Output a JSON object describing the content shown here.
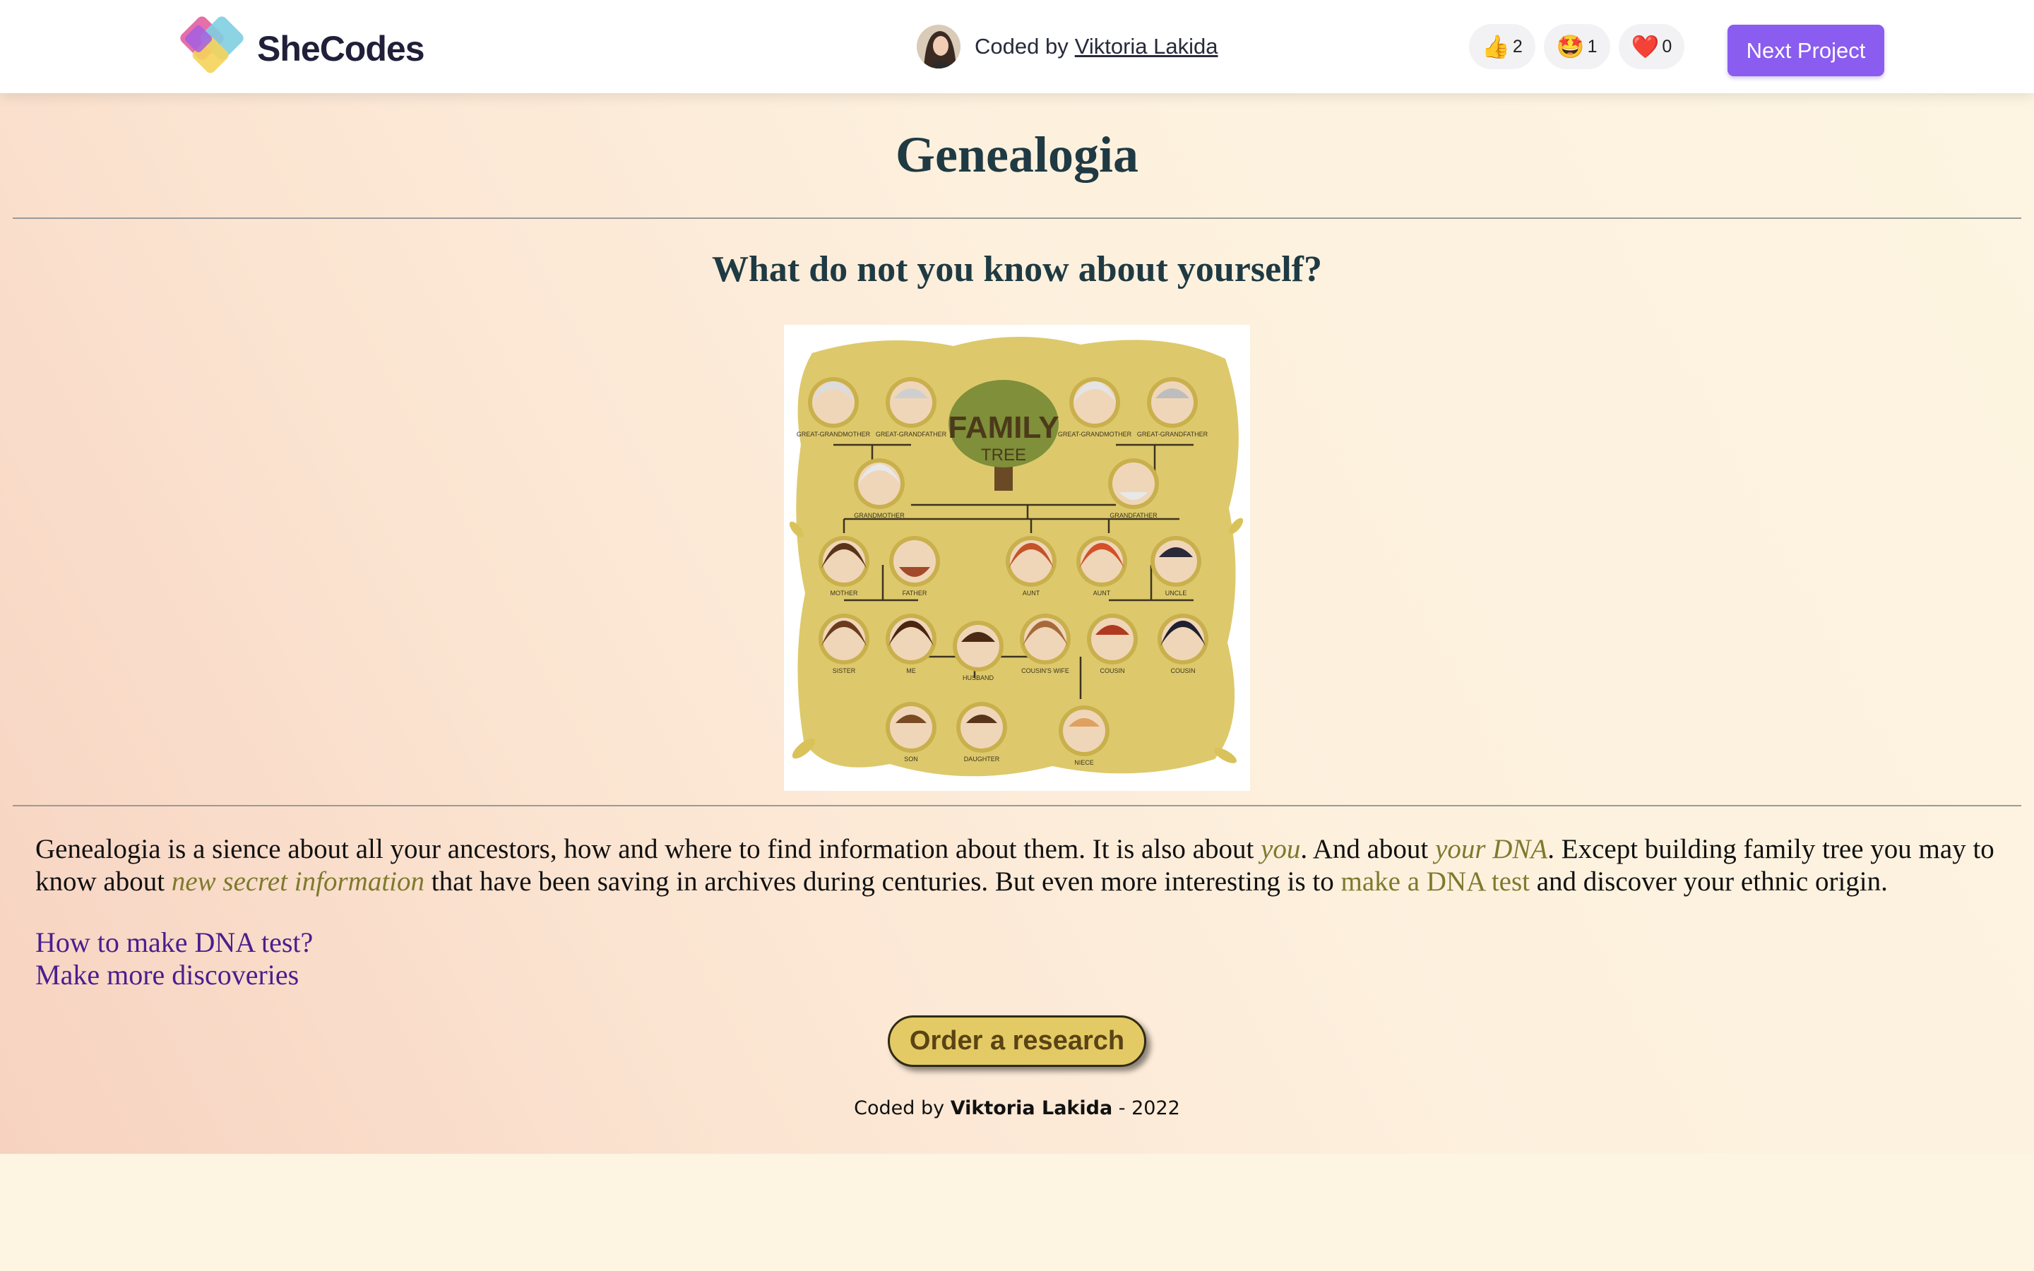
{
  "header": {
    "logo_text": "SheCodes",
    "coded_by_label": "Coded by",
    "author_name": "Viktoria Lakida",
    "reactions": [
      {
        "icon": "thumbs-up-icon",
        "glyph": "👍",
        "count": "2"
      },
      {
        "icon": "star-struck-icon",
        "glyph": "🤩",
        "count": "1"
      },
      {
        "icon": "heart-icon",
        "glyph": "❤️",
        "count": "0"
      }
    ],
    "next_button_label": "Next Project",
    "accent_color": "#8a5cf0"
  },
  "main": {
    "title": "Genealogia",
    "subtitle": "What do not you know about yourself?",
    "image": {
      "banner": "FAMILY",
      "banner_sub": "TREE",
      "labels": [
        "GREAT-GRANDMOTHER",
        "GREAT-GRANDFATHER",
        "GREAT-GRANDMOTHER",
        "GREAT-GRANDFATHER",
        "GRANDMOTHER",
        "GRANDFATHER",
        "MOTHER",
        "FATHER",
        "AUNT",
        "AUNT",
        "UNCLE",
        "SISTER",
        "ME",
        "HUSBAND",
        "COUSIN'S WIFE",
        "COUSIN",
        "COUSIN",
        "SON",
        "DAUGHTER",
        "NIECE"
      ]
    },
    "paragraph": {
      "t1": "Genealogia is a sience about all your ancestors, how and where to find information about them. It is also about ",
      "e1": "you",
      "t2": ". And about ",
      "e2": "your DNA",
      "t3": ". Except building family tree you may to know about ",
      "e3": "new secret information",
      "t4": " that have been saving in archives during centuries. But even more interesting is to ",
      "l1": "make a DNA test",
      "t5": " and discover your ethnic origin."
    },
    "links": [
      "How to make DNA test?",
      "Make more discoveries"
    ],
    "order_button_label": "Order a research"
  },
  "footer": {
    "prefix": "Coded by ",
    "name": "Viktoria Lakida",
    "suffix": " - 2022"
  }
}
